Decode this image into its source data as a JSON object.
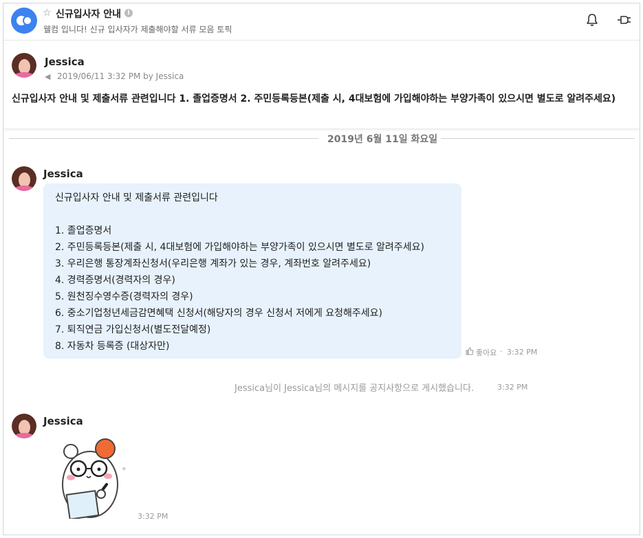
{
  "header": {
    "topic_title": "신규입사자 안내",
    "topic_description": "웰컴 입니다! 신규 입사자가 제출해야할 서류 모음 토픽",
    "info_icon": "i"
  },
  "notice": {
    "author": "Jessica",
    "meta": "2019/06/11 3:32 PM by Jessica",
    "text": "신규입사자 안내 및 제출서류 관련입니다 1. 졸업증명서 2. 주민등록등본(제출 시, 4대보험에 가입해야하는 부양가족이 있으시면 별도로 알려주세요)"
  },
  "date_divider": "2019년 6월 11일 화요일",
  "messages": [
    {
      "author": "Jessica",
      "intro": "신규입사자 안내 및 제출서류 관련입니다",
      "items": [
        "1. 졸업증명서",
        "2. 주민등록등본(제출 시, 4대보험에 가입해야하는 부양가족이 있으시면 별도로 알려주세요)",
        "3. 우리은행 통장계좌신청서(우리은행 계좌가 있는 경우, 계좌번호 알려주세요)",
        "4. 경력증명서(경력자의 경우)",
        "5. 원천징수영수증(경력자의 경우)",
        "6. 중소기업청년세금감면혜택 신청서(해당자의 경우 신청서 저에게 요청해주세요)",
        "7. 퇴직연금 가입신청서(별도전달예정)",
        "8. 자동차 등록증 (대상자만)"
      ],
      "like_label": "좋아요",
      "separator": "·",
      "time": "3:32 PM"
    },
    {
      "author": "Jessica",
      "time": "3:32 PM"
    }
  ],
  "system_message": {
    "name1": "Jessica",
    "text1": "님이 ",
    "name2": "Jessica",
    "text2": "님의 메시지를 공지사항으로 게시했습니다.",
    "time": "3:32 PM"
  },
  "icons": {
    "star": "☆",
    "megaphone": "◀",
    "like": "👍"
  }
}
